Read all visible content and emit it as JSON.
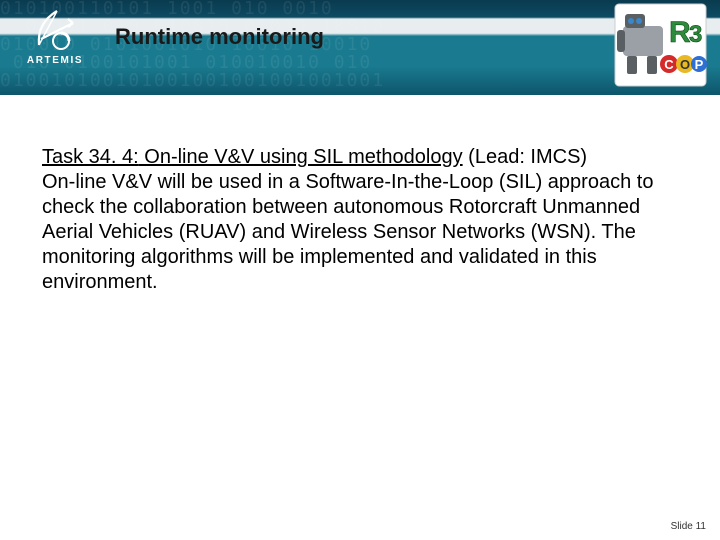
{
  "header": {
    "logo_left_name": "ARTEMIS",
    "slide_title": "Runtime monitoring",
    "logo_right_label": "R3",
    "logo_right_sub": "COP"
  },
  "content": {
    "task_label": "Task 34. 4:",
    "task_name": " On-line V&V using SIL methodology",
    "task_lead": " (Lead: IMCS)",
    "body": "On-line V&V will be used in a Software-In-the-Loop (SIL) approach to check the collaboration between autonomous Rotorcraft Unmanned Aerial Vehicles (RUAV) and Wireless Sensor Networks (WSN). The monitoring algorithms will be implemented and validated in this environment."
  },
  "footer": {
    "slide_number_label": "Slide 11"
  }
}
